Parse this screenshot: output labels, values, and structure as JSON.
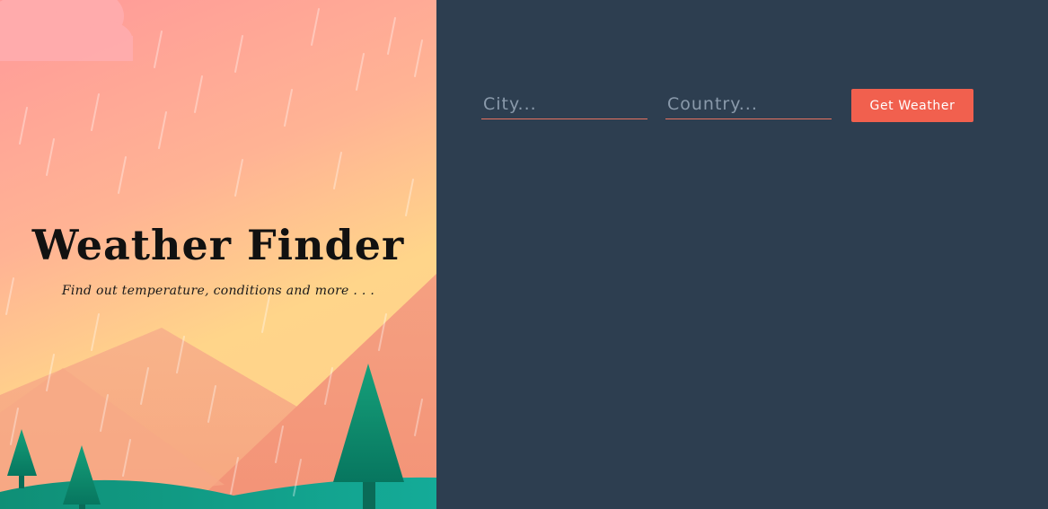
{
  "hero": {
    "title": "Weather Finder",
    "subtitle": "Find out temperature, conditions and more . . ."
  },
  "search": {
    "city_placeholder": "City...",
    "country_placeholder": "Country...",
    "city_value": "",
    "country_value": "",
    "submit_label": "Get Weather"
  },
  "colors": {
    "panel_background": "#2d3e50",
    "accent": "#f1604e",
    "sky_top": "#ff9999",
    "sky_bottom": "#ffd58a",
    "tree": "#0b8a6e"
  }
}
